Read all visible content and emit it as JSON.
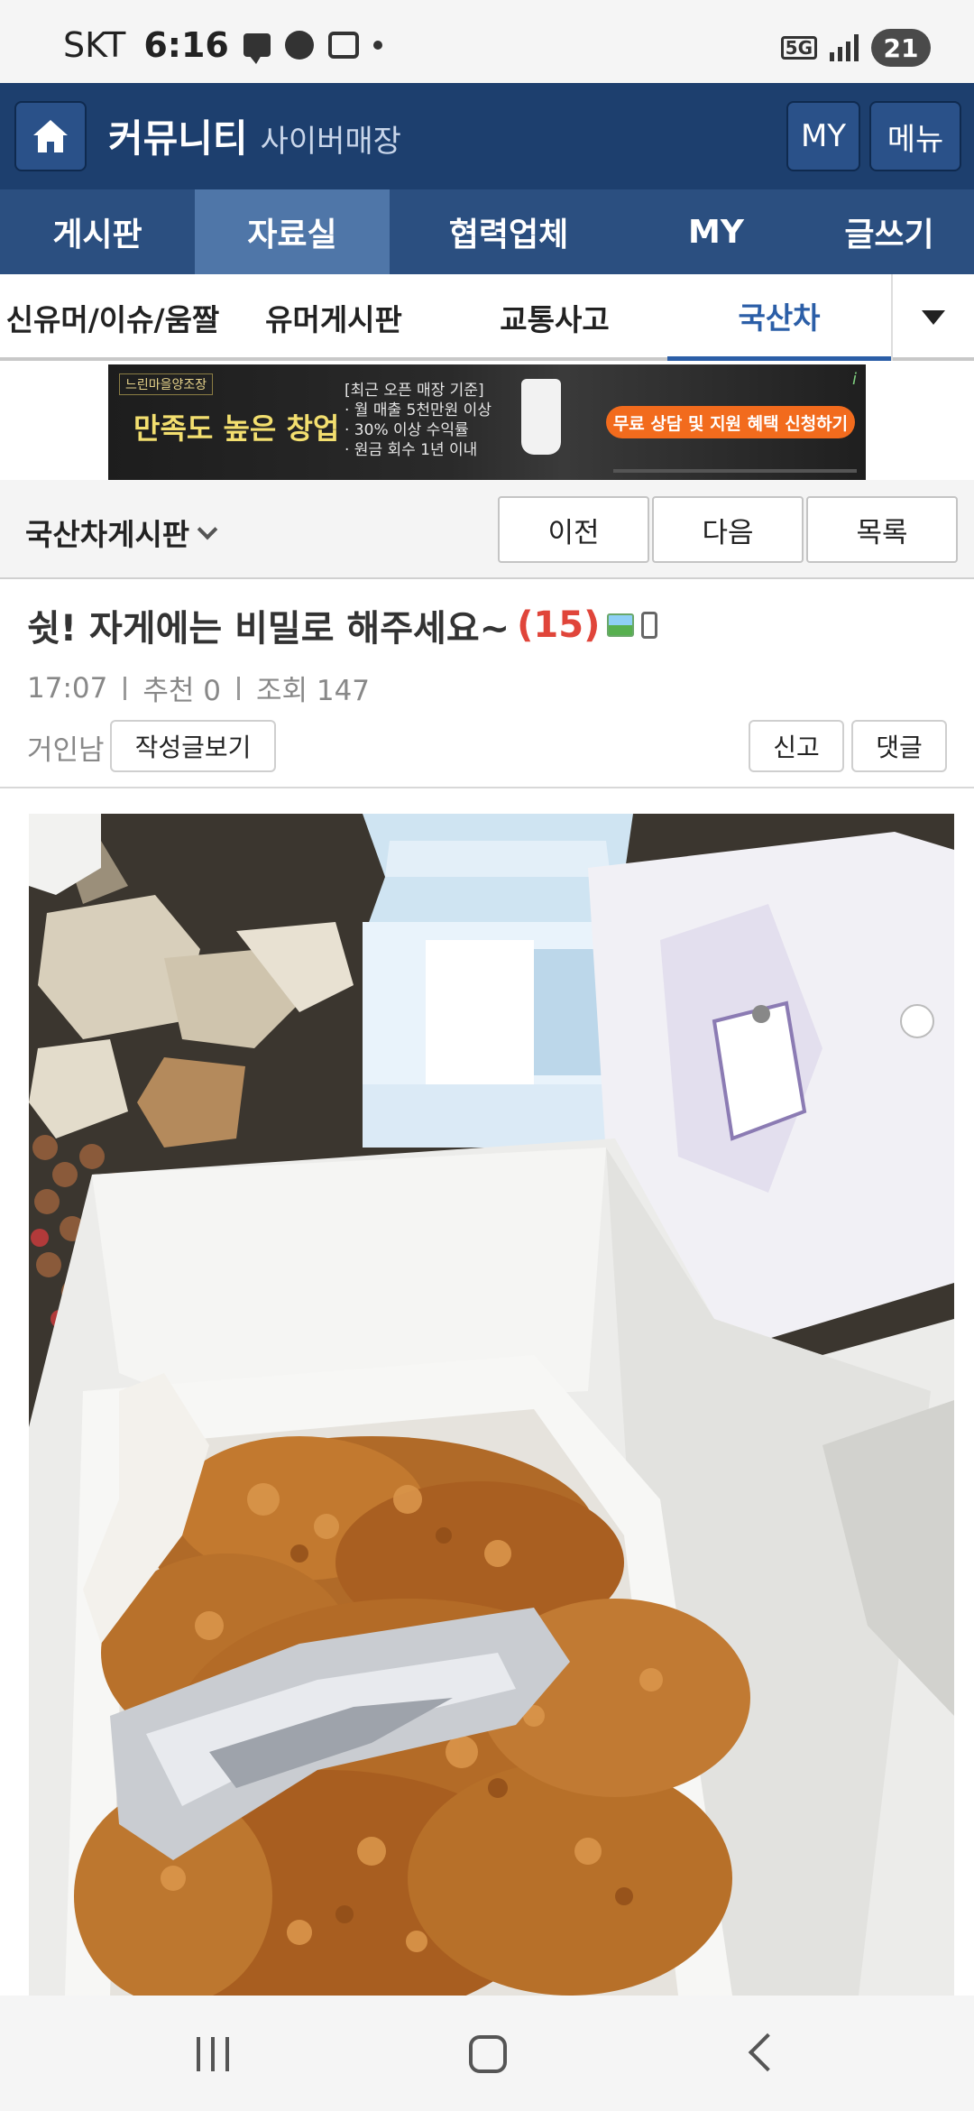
{
  "status_bar": {
    "carrier": "SKT",
    "time": "6:16",
    "network": "5G",
    "battery": "21"
  },
  "header": {
    "title": "커뮤니티",
    "subtitle": "사이버매장",
    "my_label": "MY",
    "menu_label": "메뉴"
  },
  "main_tabs": [
    {
      "label": "게시판"
    },
    {
      "label": "자료실"
    },
    {
      "label": "협력업체"
    },
    {
      "label": "MY"
    },
    {
      "label": "글쓰기"
    }
  ],
  "sub_tabs": [
    {
      "label": "신유머/이슈/움짤"
    },
    {
      "label": "유머게시판"
    },
    {
      "label": "교통사고"
    },
    {
      "label": "국산차"
    }
  ],
  "ad": {
    "brand": "느린마을양조장",
    "headline": "만족도 높은 창업",
    "bullets": [
      "[최근 오픈 매장 기준]",
      "· 월 매출 5천만원 이상",
      "· 30% 이상 수익률",
      "· 원금 회수 1년 이내"
    ],
    "cta": "무료 상담 및 지원 혜택 신청하기"
  },
  "board": {
    "name": "국산차게시판",
    "prev_label": "이전",
    "next_label": "다음",
    "list_label": "목록"
  },
  "post": {
    "title": "쉿! 자게에는 비밀로 해주세요~",
    "comment_count": "(15)",
    "time": "17:07",
    "recommend": "추천 0",
    "views": "조회 147",
    "author": "거인남",
    "view_posts_label": "작성글보기",
    "report_label": "신고",
    "comment_label": "댓글"
  },
  "colors": {
    "header_bg": "#1d3f6e",
    "tabs_bg": "#2b4f80",
    "active_tab_bg": "#4f76a8",
    "active_subtab": "#2b5ea7",
    "comment_count": "#e0453a"
  },
  "icons": {
    "home": "home-icon",
    "dropdown": "caret-down-icon",
    "image_attached": "image-icon",
    "mobile_post": "mobile-icon"
  }
}
